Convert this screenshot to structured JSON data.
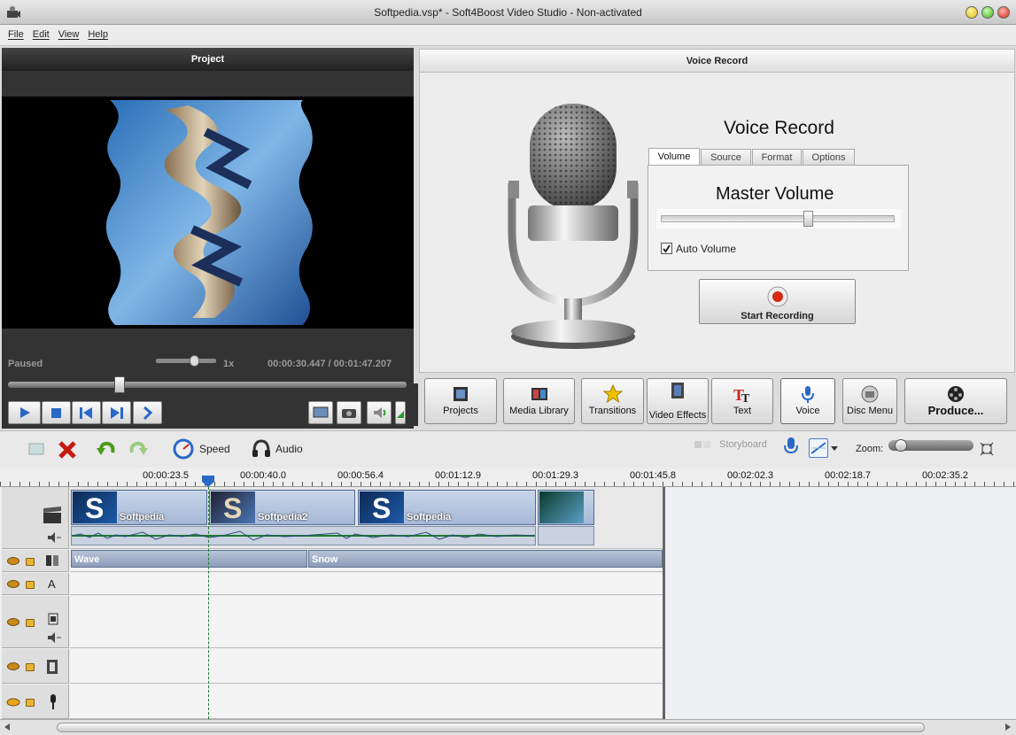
{
  "window": {
    "title": "Softpedia.vsp* - Soft4Boost Video Studio - Non-activated"
  },
  "menu": [
    "File",
    "Edit",
    "View",
    "Help"
  ],
  "project": {
    "header": "Project",
    "status": "Paused",
    "speed": "1x",
    "current_time": "00:00:30.447",
    "separator": "/",
    "total_time": "00:01:47.207",
    "seek_fraction": 0.28
  },
  "voice_record": {
    "header": "Voice Record",
    "title": "Voice Record",
    "tabs": [
      "Volume",
      "Source",
      "Format",
      "Options"
    ],
    "active_tab": "Volume",
    "master_volume_label": "Master Volume",
    "master_volume_fraction": 0.63,
    "auto_volume_label": "Auto Volume",
    "auto_volume_checked": true,
    "start_button": "Start Recording"
  },
  "tools": [
    {
      "name": "projects",
      "label": "Projects"
    },
    {
      "name": "media-library",
      "label": "Media Library"
    },
    {
      "name": "transitions",
      "label": "Transitions"
    },
    {
      "name": "video-effects",
      "label": "Video Effects"
    },
    {
      "name": "text",
      "label": "Text"
    },
    {
      "name": "voice",
      "label": "Voice"
    },
    {
      "name": "disc-menu",
      "label": "Disc Menu"
    },
    {
      "name": "produce",
      "label": "Produce..."
    }
  ],
  "edit_toolbar": {
    "speed_label": "Speed",
    "audio_label": "Audio",
    "storyboard_label": "Storyboard",
    "zoom_label": "Zoom:"
  },
  "ruler": [
    "00:00:23.5",
    "00:00:40.0",
    "00:00:56.4",
    "00:01:12.9",
    "00:01:29.3",
    "00:01:45.8",
    "00:02:02.3",
    "00:02:18.7",
    "00:02:35.2"
  ],
  "clips": [
    "Softpedia",
    "Softpedia2",
    "Softpedia",
    ""
  ],
  "transitions": [
    "Wave",
    "Snow"
  ],
  "track_icons": {
    "video": "clapper-icon",
    "transitions": "transition-icon",
    "text": "text-icon",
    "overlay": "overlay-icon",
    "effects": "film-icon",
    "voice": "microphone-icon"
  }
}
